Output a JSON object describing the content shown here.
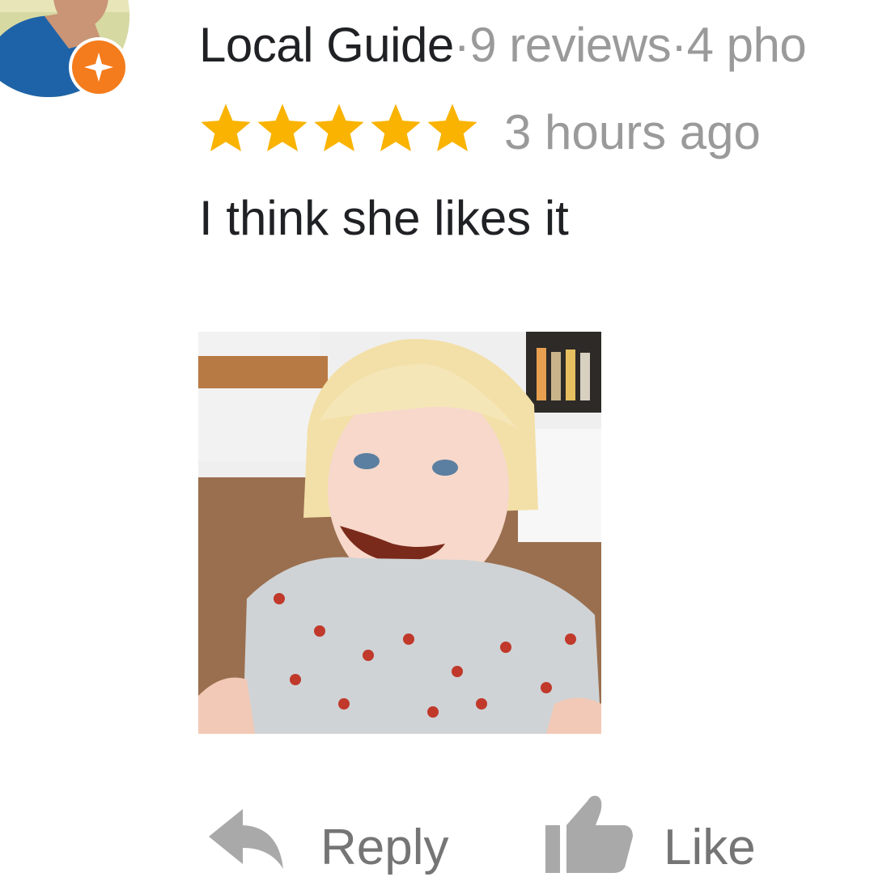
{
  "reviewer": {
    "badge_label": "Local Guide",
    "separator": "·",
    "reviews": "9 reviews",
    "photos": "4 pho"
  },
  "review": {
    "rating": 5,
    "rating_max": 5,
    "time": "3 hours ago",
    "text": "I think she likes it"
  },
  "actions": {
    "reply_label": "Reply",
    "like_label": "Like"
  },
  "icons": {
    "star": "star-icon",
    "reply": "reply-arrow-icon",
    "like": "thumbs-up-icon",
    "guide": "local-guide-star-icon"
  },
  "colors": {
    "star": "#f9b300",
    "guide_badge": "#f47c1c",
    "primary_text": "#202124",
    "muted_text": "#9a9a9a",
    "action_text": "#757575",
    "action_icon": "#a9a9a9"
  }
}
